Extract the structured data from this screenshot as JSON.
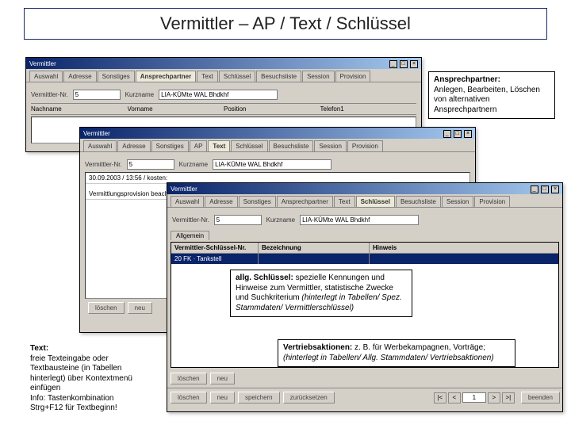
{
  "slide_title": "Vermittler – AP / Text / Schlüssel",
  "win_title": "Vermittler",
  "win_min": "_",
  "win_max": "□",
  "win_close": "×",
  "tabs": {
    "t1": "Auswahl",
    "t2": "Adresse",
    "t3": "Sonstiges",
    "t4": "Ansprechpartner",
    "t5": "Text",
    "t6": "Schlüssel",
    "t7": "Besuchsliste",
    "t8": "Session",
    "t9": "Provision"
  },
  "vermittler_label": "Vermittler-Nr.",
  "vermittler_value": "5",
  "kurzname_label": "Kurzname",
  "kurzname_value": "LIA-KÜMte WAL Bhdkhf",
  "w1_cols": {
    "c1": "Nachname",
    "c2": "Vorname",
    "c3": "Position",
    "c4": "Telefon1"
  },
  "w2_date_line": "30.09.2003 / 13:56 / kosten:",
  "w2_note_line": "Vermittlungsprovision beachten",
  "w3_subtab": "Allgemein",
  "w3_head": {
    "c1": "Vermittler-Schlüssel-Nr.",
    "c2": "Bezeichnung",
    "c3": "Hinweis"
  },
  "w3_row": {
    "c1": "20 FK · Tankstell",
    "c2": "",
    "c3": ""
  },
  "btns": {
    "loeschen": "löschen",
    "neu": "neu",
    "speichern": "speichern",
    "loeschen2": "löschen",
    "zuruecksetzen": "zurücksetzen",
    "beenden": "beenden"
  },
  "pager": {
    "first": "|<",
    "prev": "<",
    "val": "1",
    "next": ">",
    "last": ">|"
  },
  "callouts": {
    "ap_title": "Ansprechpartner:",
    "ap_body": "Anlegen, Bearbeiten, Löschen von alternativen Ansprechpartnern",
    "sch_lead": "allg. Schlüssel:",
    "sch_body": " spezielle Kennungen und Hinweise zum Vermittler, statistische Zwecke und Suchkriterium ",
    "sch_italic": "(hinterlegt in Tabellen/ Spez. Stammdaten/ Vermittlerschlüssel)",
    "va_lead": "Vertriebsaktionen:",
    "va_body": " z. B. für Werbekampagnen, Vorträge; ",
    "va_italic": "(hinterlegt in Tabellen/ Allg. Stammdaten/ Vertriebsaktionen)",
    "txt_title": "Text:",
    "txt_body": "freie Texteingabe oder Textbausteine (in Tabellen hinterlegt) über Kontextmenü einfügen\nInfo: Tastenkombination Strg+F12 für Textbeginn!"
  }
}
